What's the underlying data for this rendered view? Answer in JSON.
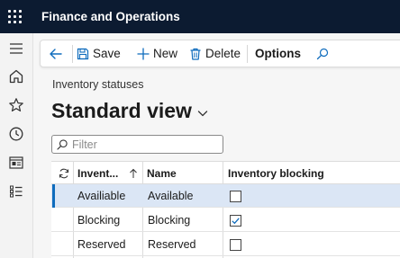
{
  "app": {
    "title": "Finance and Operations"
  },
  "toolbar": {
    "save_label": "Save",
    "new_label": "New",
    "delete_label": "Delete",
    "options_label": "Options"
  },
  "page": {
    "caption": "Inventory statuses",
    "view_name": "Standard view"
  },
  "filter": {
    "placeholder": "Filter"
  },
  "grid": {
    "columns": {
      "status": "Invent...",
      "name": "Name",
      "blocking": "Inventory blocking"
    },
    "rows": [
      {
        "status": "Availiable",
        "name": "Available",
        "blocking": false,
        "selected": true
      },
      {
        "status": "Blocking",
        "name": "Blocking",
        "blocking": true,
        "selected": false
      },
      {
        "status": "Reserved",
        "name": "Reserved",
        "blocking": false,
        "selected": false
      }
    ]
  },
  "colors": {
    "topbar": "#0c1b31",
    "accent": "#0f6cbd",
    "selected_row": "#dbe6f5"
  }
}
